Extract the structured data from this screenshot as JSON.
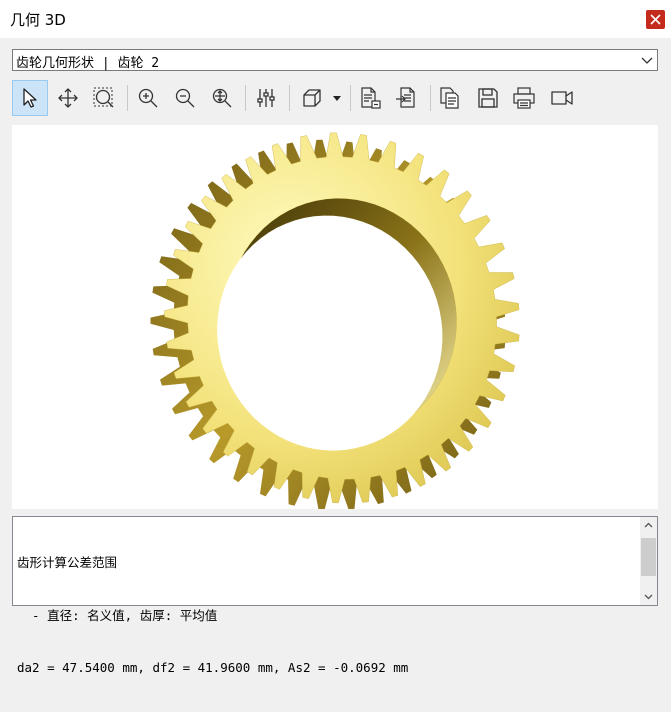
{
  "window": {
    "title": "几何 3D",
    "close_icon": "close-icon"
  },
  "dropdown": {
    "value": "齿轮几何形状 | 齿轮 2"
  },
  "toolbar": {
    "buttons": [
      {
        "name": "select-tool-button",
        "icon": "cursor-arrow-icon",
        "active": true
      },
      {
        "name": "pan-button",
        "icon": "move-arrows-icon"
      },
      {
        "name": "zoom-window-button",
        "icon": "zoom-window-icon"
      },
      {
        "name": "zoom-in-button",
        "icon": "zoom-in-icon"
      },
      {
        "name": "zoom-out-button",
        "icon": "zoom-out-icon"
      },
      {
        "name": "zoom-fit-button",
        "icon": "zoom-fit-icon"
      },
      {
        "name": "settings-sliders-button",
        "icon": "sliders-icon"
      },
      {
        "name": "view-cube-button",
        "icon": "cube-icon"
      },
      {
        "name": "view-dropdown-button",
        "icon": "dropdown-arrow-icon"
      },
      {
        "name": "export-document-button",
        "icon": "document-export-icon"
      },
      {
        "name": "import-document-button",
        "icon": "document-import-icon"
      },
      {
        "name": "copy-button",
        "icon": "copy-icon"
      },
      {
        "name": "save-button",
        "icon": "save-icon"
      },
      {
        "name": "print-button",
        "icon": "printer-icon"
      },
      {
        "name": "record-video-button",
        "icon": "video-camera-icon"
      }
    ]
  },
  "viewport": {
    "object": "helical-gear-3d",
    "colors": {
      "tooth_light": "#fffbc0",
      "tooth_dark": "#6e5a14",
      "face": "#f3e27a"
    }
  },
  "output": {
    "lines": [
      "齿形计算公差范围",
      "  - 直径: 名义值, 齿厚: 平均值",
      "da2 = 47.5400 mm, df2 = 41.9600 mm, As2 = -0.0692 mm"
    ]
  }
}
